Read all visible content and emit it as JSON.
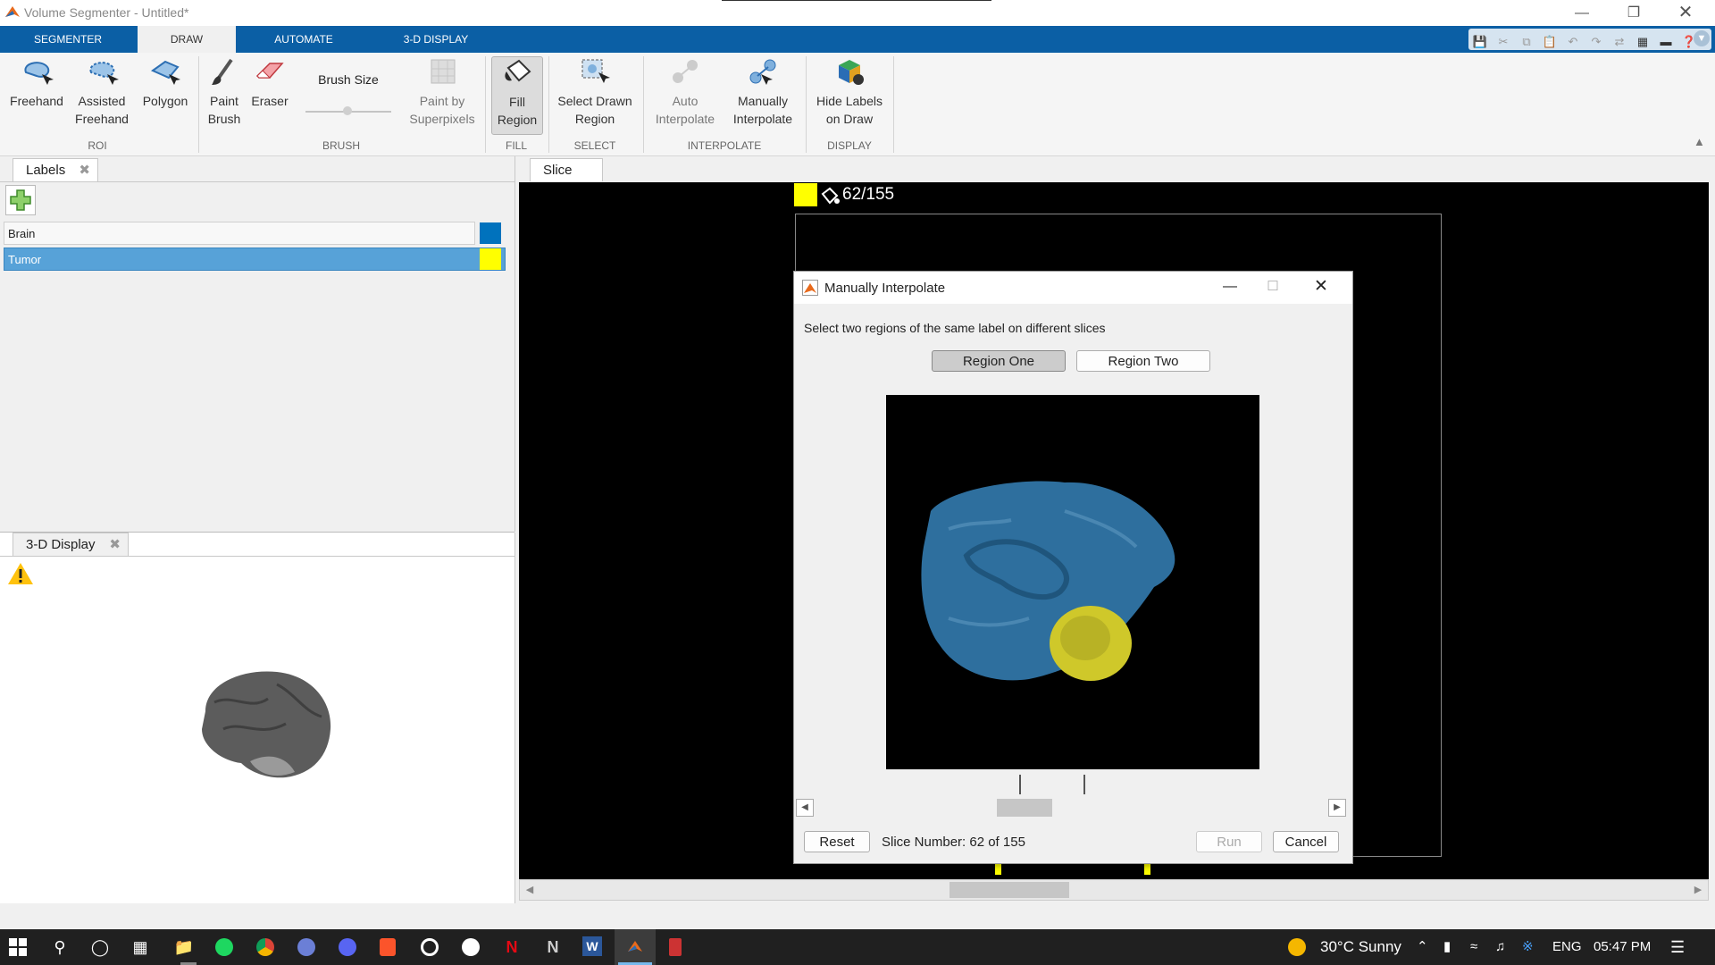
{
  "window": {
    "title": "Volume Segmenter - Untitled*"
  },
  "tabs": [
    {
      "label": "SEGMENTER"
    },
    {
      "label": "DRAW"
    },
    {
      "label": "AUTOMATE"
    },
    {
      "label": "3-D DISPLAY"
    }
  ],
  "ribbon": {
    "freehand": "Freehand",
    "assisted_1": "Assisted",
    "assisted_2": "Freehand",
    "polygon": "Polygon",
    "roi_group": "ROI",
    "paint_1": "Paint",
    "paint_2": "Brush",
    "eraser": "Eraser",
    "brush_size": "Brush Size",
    "superpixels_1": "Paint by",
    "superpixels_2": "Superpixels",
    "brush_group": "BRUSH",
    "fill_1": "Fill",
    "fill_2": "Region",
    "fill_group": "FILL",
    "select_1": "Select Drawn",
    "select_2": "Region",
    "select_group": "SELECT",
    "auto_1": "Auto",
    "auto_2": "Interpolate",
    "manual_1": "Manually",
    "manual_2": "Interpolate",
    "interp_group": "INTERPOLATE",
    "hide_1": "Hide Labels",
    "hide_2": "on Draw",
    "display_group": "DISPLAY"
  },
  "labels_panel": {
    "tab": "Labels",
    "items": [
      {
        "name": "Brain",
        "color": "#0072bd"
      },
      {
        "name": "Tumor",
        "color": "#ffff00"
      }
    ]
  },
  "display_panel": {
    "tab": "3-D Display"
  },
  "slice_panel": {
    "tab": "Slice",
    "counter": "62/155"
  },
  "dialog": {
    "title": "Manually Interpolate",
    "instruction": "Select two regions of the same label on different slices",
    "region_one": "Region One",
    "region_two": "Region Two",
    "reset": "Reset",
    "slice_number": "Slice Number: 62 of 155",
    "run": "Run",
    "cancel": "Cancel"
  },
  "taskbar": {
    "weather": "30°C  Sunny",
    "language": "ENG",
    "time": "05:47 PM"
  }
}
